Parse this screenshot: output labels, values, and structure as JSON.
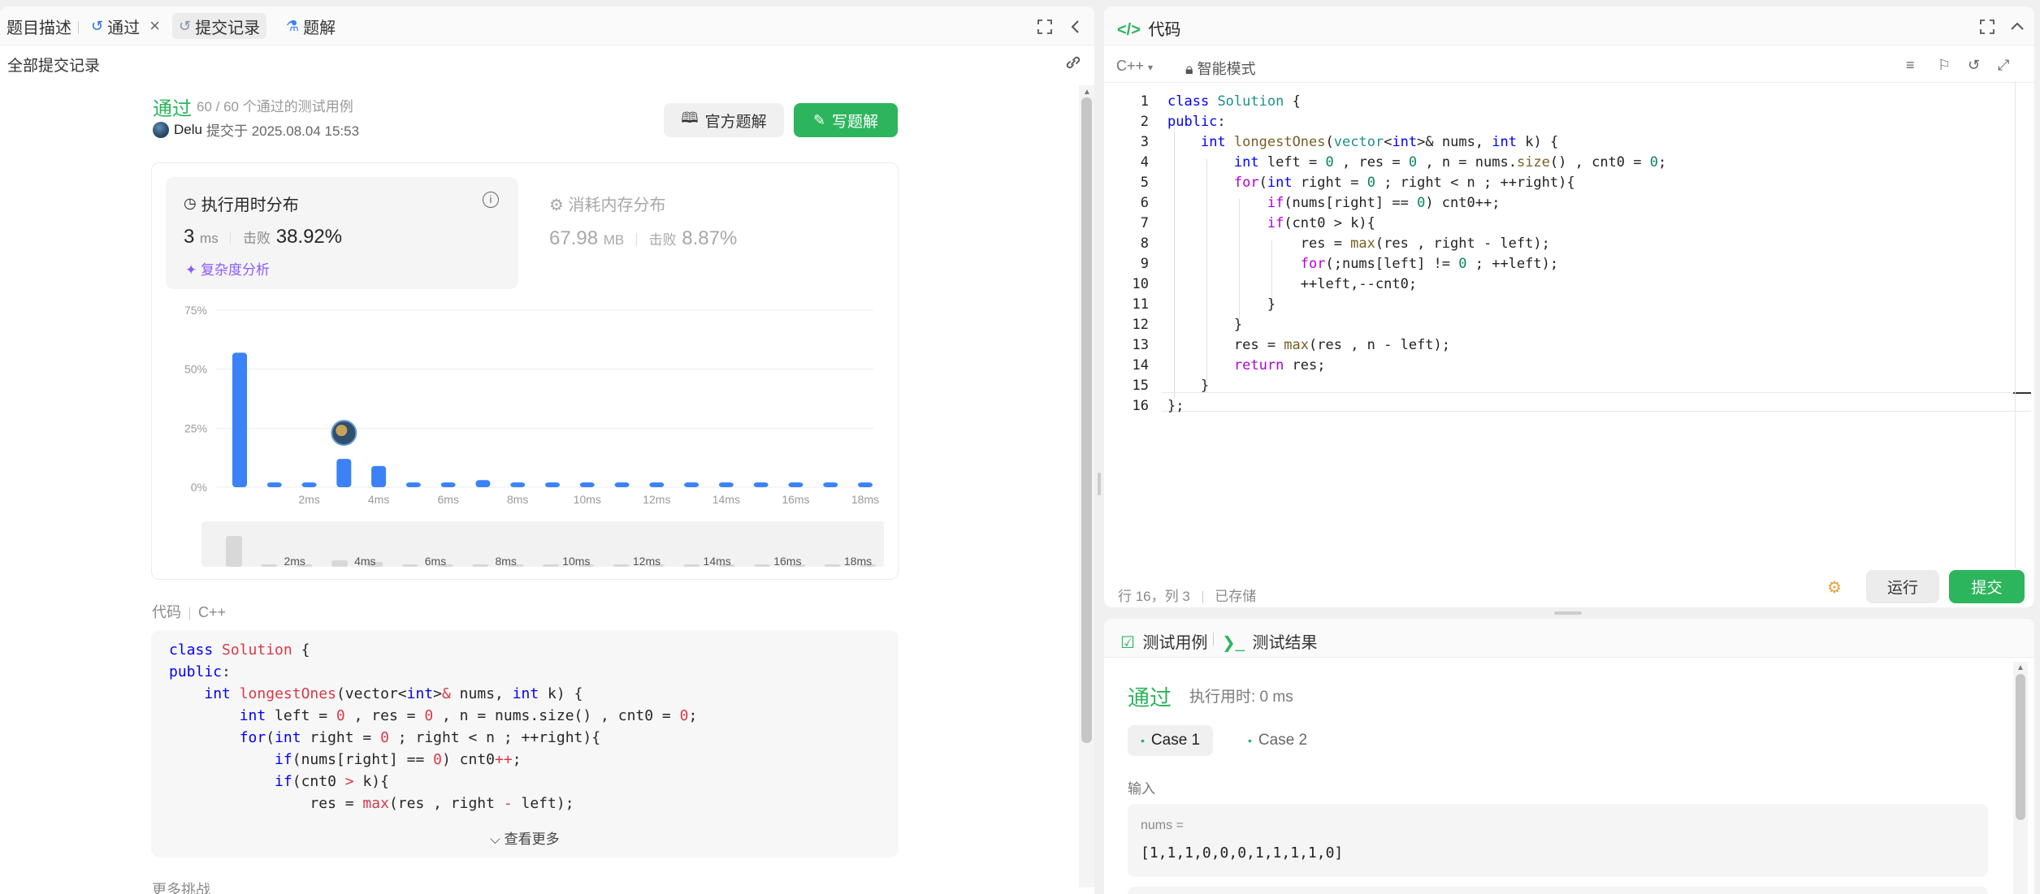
{
  "left_tabs": {
    "description": "题目描述",
    "passed": "通过",
    "close": "×",
    "submissions": "提交记录",
    "solutions": "题解"
  },
  "subheader": "全部提交记录",
  "result": {
    "status": "通过",
    "cases": "60 / 60 个通过的测试用例",
    "user": "Delu",
    "submitted_at": "提交于 2025.08.04 15:53"
  },
  "buttons": {
    "official": "官方题解",
    "write": "写题解"
  },
  "runtime": {
    "title": "执行用时分布",
    "value": "3",
    "unit": "ms",
    "beats_label": "击败",
    "beats": "38.92%",
    "complexity": "复杂度分析"
  },
  "memory": {
    "title": "消耗内存分布",
    "value": "67.98",
    "unit": "MB",
    "beats_label": "击败",
    "beats": "8.87%"
  },
  "chart_data": {
    "type": "bar",
    "title": "",
    "xlabel": "",
    "ylabel": "",
    "ylim": [
      0,
      75
    ],
    "yticks": [
      "0%",
      "25%",
      "50%",
      "75%"
    ],
    "ytick_values": [
      0,
      25,
      50,
      75
    ],
    "xtick_labels": [
      "2ms",
      "4ms",
      "6ms",
      "8ms",
      "10ms",
      "12ms",
      "14ms",
      "16ms",
      "18ms"
    ],
    "categories": [
      "0ms",
      "1ms",
      "2ms",
      "3ms",
      "4ms",
      "5ms",
      "6ms",
      "7ms",
      "8ms",
      "9ms",
      "10ms",
      "11ms",
      "12ms",
      "13ms",
      "14ms",
      "15ms",
      "16ms",
      "17ms",
      "18ms"
    ],
    "values": [
      57,
      2,
      2,
      12,
      9,
      2,
      2,
      3,
      2,
      2,
      2,
      2,
      2,
      2,
      2,
      2,
      2,
      2,
      2
    ],
    "highlight_category": "3ms",
    "grid": true,
    "bar_color": "#3b82f6",
    "overview": {
      "type": "bar",
      "values": [
        57,
        2,
        2,
        12,
        9,
        2,
        2,
        3,
        2,
        2,
        2,
        2,
        2,
        2,
        2,
        2,
        2,
        2,
        2
      ],
      "xtick_labels": [
        "2ms",
        "4ms",
        "6ms",
        "8ms",
        "10ms",
        "12ms",
        "14ms",
        "16ms",
        "18ms"
      ]
    }
  },
  "code_section": {
    "label": "代码",
    "lang": "C++",
    "see_more": "查看更多",
    "more": "更多挑战"
  },
  "editor": {
    "title": "代码",
    "lang": "C++",
    "mode": "智能模式",
    "status_pos": "行 16，列 3",
    "status_saved": "已存储",
    "run": "运行",
    "submit": "提交",
    "line_numbers": [
      "1",
      "2",
      "3",
      "4",
      "5",
      "6",
      "7",
      "8",
      "9",
      "10",
      "11",
      "12",
      "13",
      "14",
      "15",
      "16"
    ]
  },
  "results_panel": {
    "tab_cases": "测试用例",
    "tab_results": "测试结果",
    "status": "通过",
    "time": "执行用时: 0 ms",
    "case1": "Case 1",
    "case2": "Case 2",
    "input_label": "输入",
    "var_name": "nums =",
    "var_value": "[1,1,1,0,0,0,1,1,1,1,0]"
  },
  "colors": {
    "green": "#2db55d",
    "bar_blue": "#3b82f6",
    "purple": "#8b5cf6"
  }
}
